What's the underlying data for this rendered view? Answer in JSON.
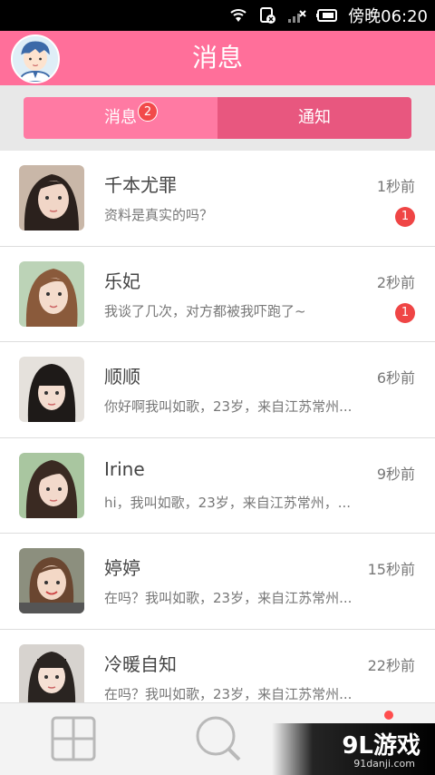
{
  "status_bar": {
    "carrier_text": "傍晚06:20",
    "icons": [
      "wifi-icon",
      "sim-icon",
      "signal-icon",
      "battery-icon"
    ]
  },
  "header": {
    "title": "消息",
    "avatar": "user-avatar-icon"
  },
  "tabs": [
    {
      "label": "消息",
      "badge": "2",
      "active": true
    },
    {
      "label": "通知",
      "active": false
    }
  ],
  "messages": [
    {
      "name": "千本尤罪",
      "time": "1秒前",
      "preview": "资料是真实的吗？",
      "unread": "1"
    },
    {
      "name": "乐妃",
      "time": "2秒前",
      "preview": "我谈了几次，对方都被我吓跑了~",
      "unread": "1"
    },
    {
      "name": "顺顺",
      "time": "6秒前",
      "preview": "你好啊我叫如歌，23岁，来自江苏常州...",
      "unread": ""
    },
    {
      "name": "Irine",
      "time": "9秒前",
      "preview": "hi，我叫如歌，23岁，来自江苏常州，...",
      "unread": ""
    },
    {
      "name": "婷婷",
      "time": "15秒前",
      "preview": "在吗？我叫如歌，23岁，来自江苏常州...",
      "unread": ""
    },
    {
      "name": "冷暖自知",
      "time": "22秒前",
      "preview": "在吗？我叫如歌，23岁，来自江苏常州...",
      "unread": ""
    }
  ],
  "bottom_nav": {
    "items": [
      "grid-icon",
      "search-icon",
      "message-icon"
    ]
  },
  "watermark": {
    "text": "9L游戏",
    "sub": "91danji.com"
  },
  "colors": {
    "brand_pink": "#ff6f9a",
    "tab_active": "#ff7aa3",
    "tab_inactive": "#e8577f",
    "badge_red": "#ef4545"
  }
}
